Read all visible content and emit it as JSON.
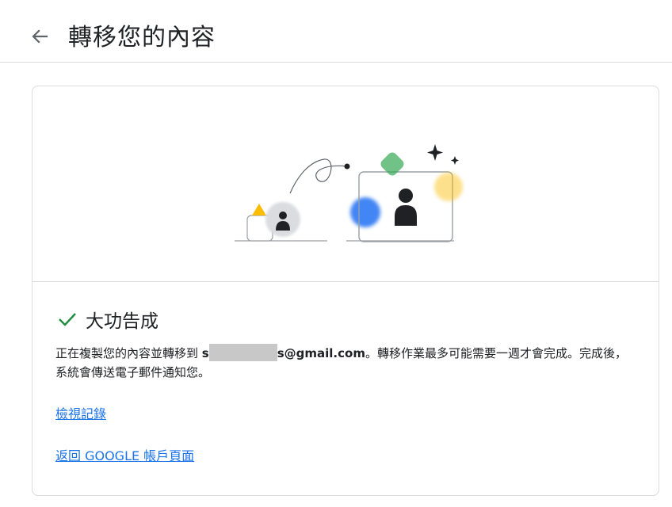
{
  "header": {
    "back_icon": "arrow-left-icon",
    "title": "轉移您的內容"
  },
  "status": {
    "icon": "check-icon",
    "icon_color": "#1e8e3e",
    "title": "大功告成"
  },
  "message": {
    "prefix": "正在複製您的內容並轉移到 ",
    "email_start": "s",
    "email_end": "s@gmail.com",
    "suffix": "。轉移作業最多可能需要一週才會完成。完成後，系統會傳送電子郵件通知您。"
  },
  "links": {
    "view_history": "檢視記錄",
    "back_to_account": "返回 GOOGLE 帳戶頁面"
  },
  "colors": {
    "link": "#1a73e8",
    "divider": "#dadce0",
    "accent_blue": "#4285f4",
    "accent_green": "#34a853",
    "accent_yellow": "#fbbc04"
  }
}
